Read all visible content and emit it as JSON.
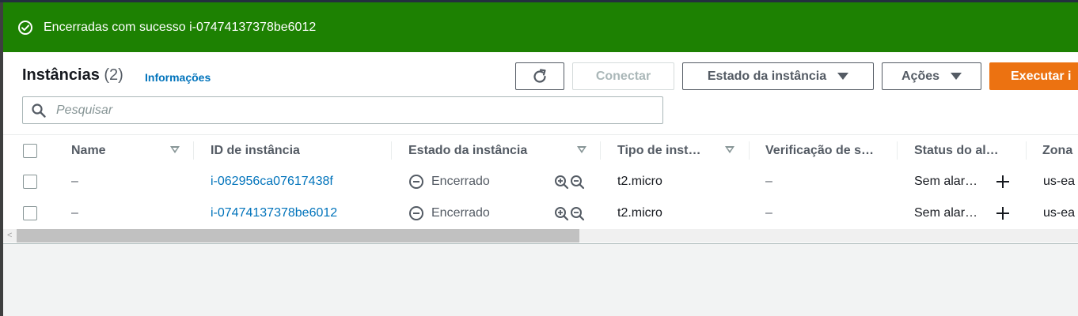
{
  "flash": {
    "message": "Encerradas com sucesso i-07474137378be6012",
    "icon": "check-circle-icon",
    "color": "#1d8102"
  },
  "header": {
    "title": "Instâncias",
    "count": "(2)",
    "info_link": "Informações"
  },
  "toolbar": {
    "refresh_icon": "refresh-icon",
    "connect_label": "Conectar",
    "instance_state_label": "Estado da instância",
    "actions_label": "Ações",
    "launch_label": "Executar i"
  },
  "search": {
    "placeholder": "Pesquisar",
    "value": ""
  },
  "table": {
    "columns": [
      "Name",
      "ID de instância",
      "Estado da instância",
      "Tipo de inst…",
      "Verificação de s…",
      "Status do al…",
      "Zona"
    ],
    "rows": [
      {
        "name": "–",
        "instance_id": "i-062956ca07617438f",
        "state": "Encerrado",
        "type": "t2.micro",
        "status_check": "–",
        "alarm_status": "Sem alar…",
        "zone": "us-ea"
      },
      {
        "name": "–",
        "instance_id": "i-07474137378be6012",
        "state": "Encerrado",
        "type": "t2.micro",
        "status_check": "–",
        "alarm_status": "Sem alar…",
        "zone": "us-ea"
      }
    ]
  },
  "colors": {
    "primary_orange": "#ec7211",
    "link_blue": "#0073bb",
    "success_green": "#1d8102"
  }
}
